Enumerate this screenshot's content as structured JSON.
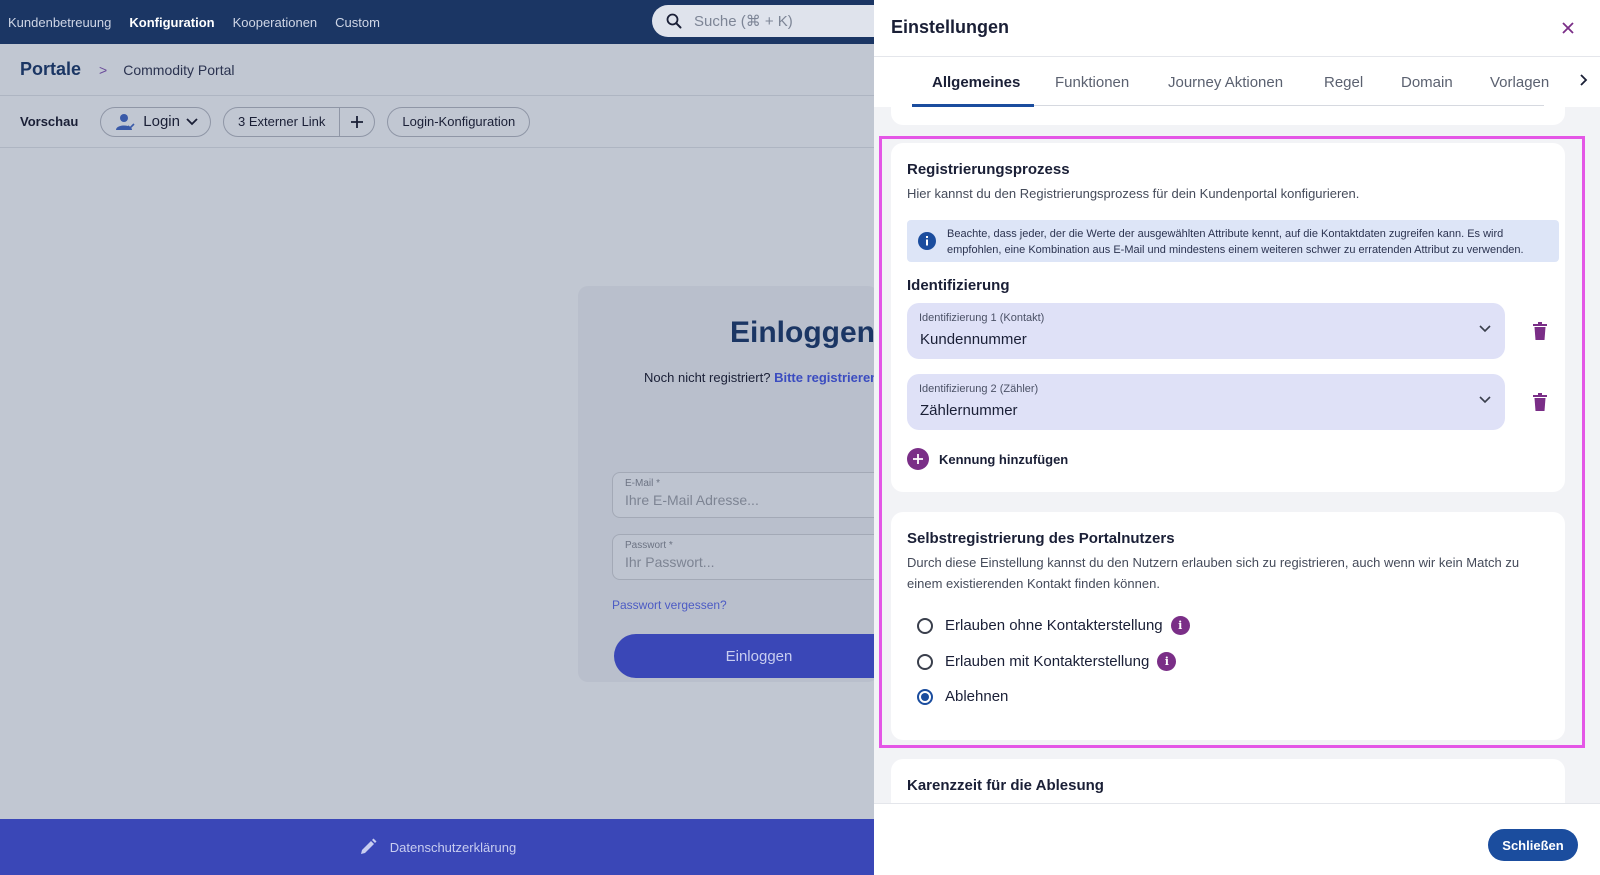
{
  "topnav": {
    "items": [
      {
        "label": "Kundenbetreuung"
      },
      {
        "label": "Konfiguration"
      },
      {
        "label": "Kooperationen"
      },
      {
        "label": "Custom"
      }
    ],
    "active_index": 1,
    "search_placeholder": "Suche (⌘ + K)"
  },
  "breadcrumb": {
    "title": "Portale",
    "separator": ">",
    "current": "Commodity Portal"
  },
  "preview": {
    "label": "Vorschau",
    "login_pill": "Login",
    "external_links": "3 Externer Link",
    "add": "+",
    "login_config": "Login-Konfiguration"
  },
  "login_card": {
    "title": "Einloggen",
    "subtitle": "Noch nicht registriert?",
    "register_link": "Bitte registrieren",
    "email_label": "E-Mail *",
    "email_placeholder": "Ihre E-Mail Adresse...",
    "password_label": "Passwort *",
    "password_placeholder": "Ihr Passwort...",
    "forgot": "Passwort vergessen?",
    "submit": "Einloggen"
  },
  "footer": {
    "privacy": "Datenschutzerklärung"
  },
  "drawer": {
    "title": "Einstellungen",
    "tabs": [
      {
        "label": "Allgemeines"
      },
      {
        "label": "Funktionen"
      },
      {
        "label": "Journey Aktionen"
      },
      {
        "label": "Regel"
      },
      {
        "label": "Domain"
      },
      {
        "label": "Vorlagen"
      }
    ],
    "active_tab": 0,
    "registration": {
      "title": "Registrierungsprozess",
      "description": "Hier kannst du den Registrierungsprozess für dein Kundenportal konfigurieren.",
      "info": "Beachte, dass jeder, der die Werte der ausgewählten Attribute kennt, auf die Kontaktdaten zugreifen kann. Es wird empfohlen, eine Kombination aus E-Mail und mindestens einem weiteren schwer zu erratenden Attribut zu verwenden.",
      "identification_title": "Identifizierung",
      "identifiers": [
        {
          "label": "Identifizierung 1 (Kontakt)",
          "value": "Kundennummer"
        },
        {
          "label": "Identifizierung 2 (Zähler)",
          "value": "Zählernummer"
        }
      ],
      "add_identifier": "Kennung hinzufügen"
    },
    "self_registration": {
      "title": "Selbstregistrierung des Portalnutzers",
      "description": "Durch diese Einstellung kannst du den Nutzern erlauben sich zu registrieren, auch wenn wir kein Match zu einem existierenden Kontakt finden können.",
      "options": [
        {
          "label": "Erlauben ohne Kontakterstellung",
          "has_info": true
        },
        {
          "label": "Erlauben mit Kontakterstellung",
          "has_info": true
        },
        {
          "label": "Ablehnen",
          "has_info": false
        }
      ],
      "selected_index": 2
    },
    "grace_period": {
      "title": "Karenzzeit für die Ablesung"
    },
    "footer_button": "Schließen"
  },
  "colors": {
    "nav_bg": "#1b3664",
    "primary": "#1b4d9e",
    "accent_purple": "#7a2e87",
    "highlight_border": "#e456e6",
    "login_button": "#3a47b7"
  }
}
